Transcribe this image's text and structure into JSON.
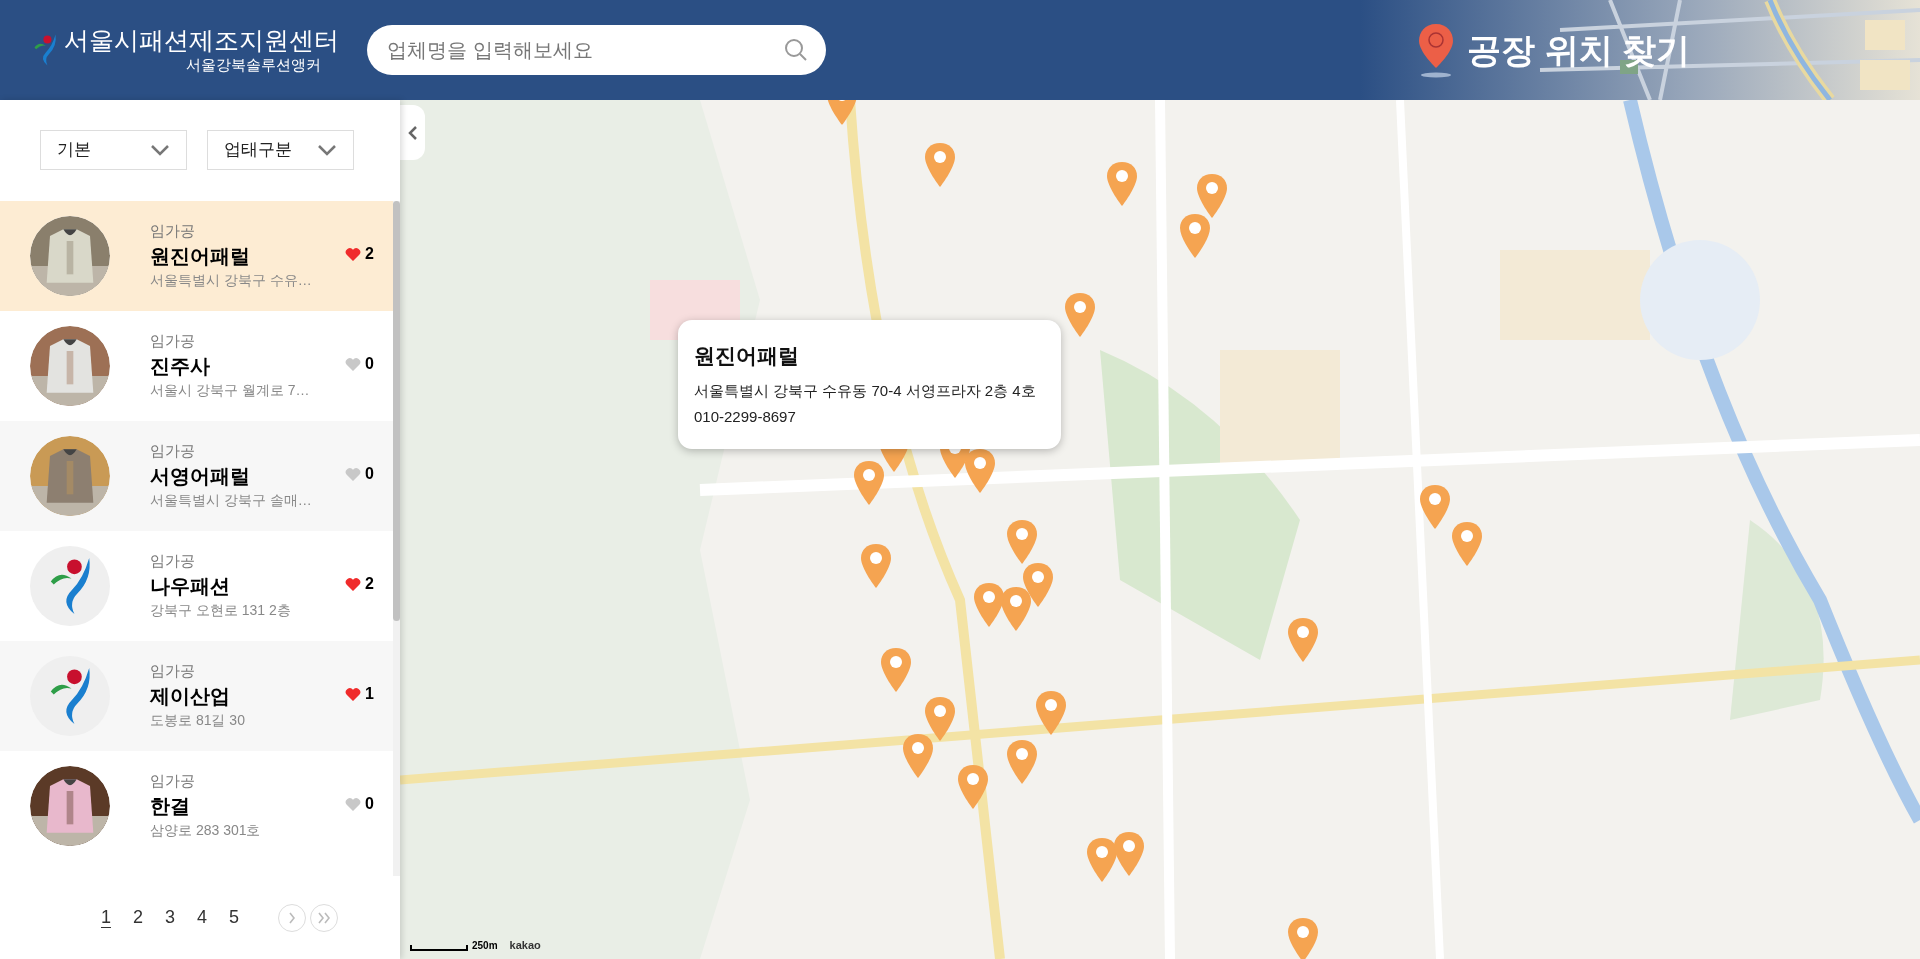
{
  "header": {
    "title": "서울시패션제조지원센터",
    "subtitle": "서울강북솔루션앵커",
    "search": {
      "placeholder": "업체명을 입력해보세요"
    },
    "page_title": "공장 위치 찾기"
  },
  "filters": [
    {
      "label": "기본"
    },
    {
      "label": "업태구분"
    }
  ],
  "companies": [
    {
      "selected": true,
      "category": "임가공",
      "name": "원진어패럴",
      "liked": true,
      "likes": "2",
      "address": "서울특별시 강북구 수유…"
    },
    {
      "selected": false,
      "category": "임가공",
      "name": "진주사",
      "liked": false,
      "likes": "0",
      "address": "서울시 강북구 월계로 7…"
    },
    {
      "selected": false,
      "category": "임가공",
      "name": "서영어패럴",
      "liked": false,
      "likes": "0",
      "address": "서울특별시 강북구 솔매…"
    },
    {
      "kind": "logo",
      "selected": false,
      "category": "임가공",
      "name": "나우패션",
      "liked": true,
      "likes": "2",
      "address": "강북구 오현로 131 2층"
    },
    {
      "kind": "logo",
      "selected": false,
      "category": "임가공",
      "name": "제이산업",
      "liked": true,
      "likes": "1",
      "address": "도봉로 81길 30"
    },
    {
      "selected": false,
      "category": "임가공",
      "name": "한결",
      "liked": false,
      "likes": "0",
      "address": "삼양로 283 301호"
    }
  ],
  "pagination": {
    "pages": [
      {
        "label": "1",
        "selected": true
      },
      {
        "label": "2",
        "selected": false
      },
      {
        "label": "3",
        "selected": false
      },
      {
        "label": "4",
        "selected": false
      },
      {
        "label": "5",
        "selected": false
      }
    ]
  },
  "map": {
    "popup": {
      "name": "원진어패럴",
      "address": "서울특별시 강북구 수유동 70-4 서영프라자 2층 4호",
      "phone": "010-2299-8697"
    },
    "scale": "250m",
    "provider": "kakao"
  }
}
